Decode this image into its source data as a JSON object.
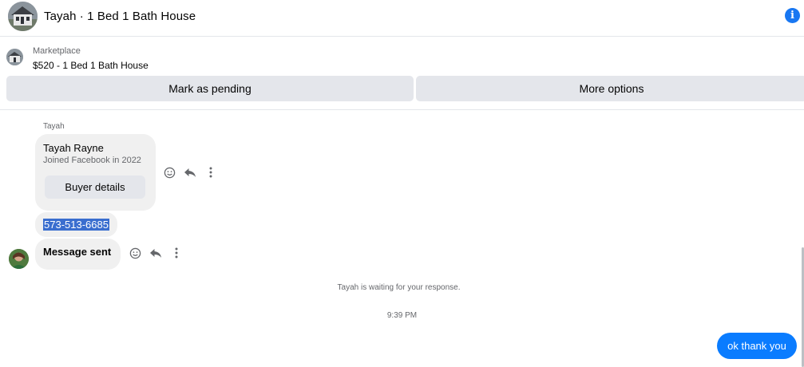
{
  "header": {
    "title": "Tayah · 1 Bed 1 Bath House",
    "info_glyph": "i"
  },
  "listing": {
    "label": "Marketplace",
    "title": "$520 - 1 Bed 1 Bath House",
    "mark_pending": "Mark as pending",
    "more_options": "More options"
  },
  "conversation": {
    "sender_name": "Tayah",
    "card": {
      "name": "Tayah Rayne",
      "joined": "Joined Facebook in 2022",
      "button": "Buyer details"
    },
    "phone_message": "573-513-6685",
    "sent_message": "Message sent",
    "waiting_status": "Tayah is waiting for your response.",
    "timestamp": "9:39 PM",
    "outgoing_message": "ok thank you"
  },
  "icons": {
    "info": "info-icon",
    "react": "emoji-icon",
    "reply": "reply-icon",
    "more": "more-icon"
  },
  "colors": {
    "accent": "#0a7cff",
    "info_blue": "#1877f2",
    "bubble_gray": "#f0f0f0",
    "button_gray": "#e4e6eb",
    "selection": "#3a6ecf"
  }
}
